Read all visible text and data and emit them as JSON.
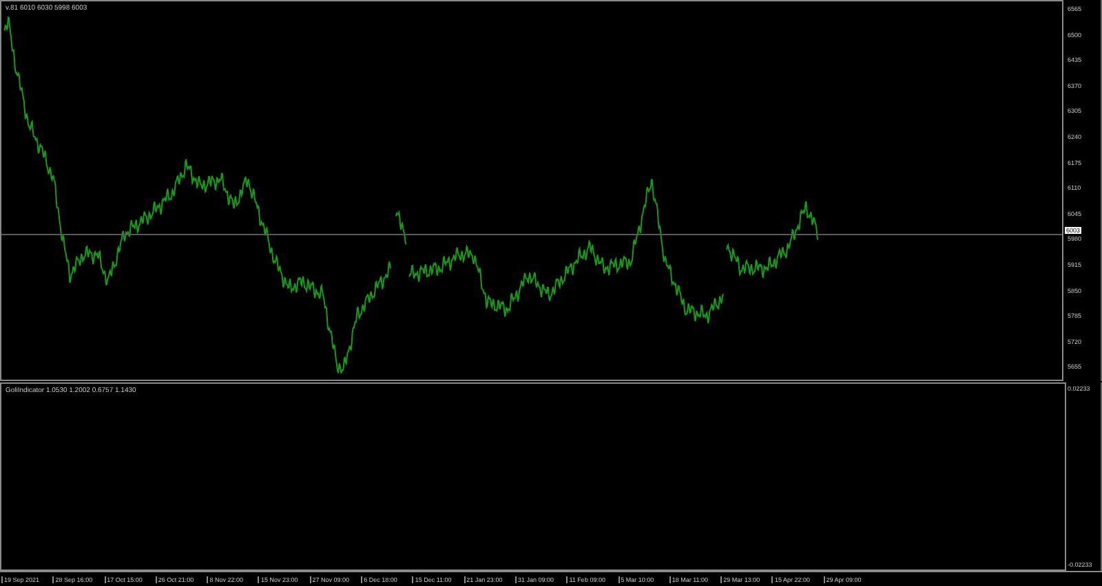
{
  "chart": {
    "header": "v.81  6010 6030 5998 6003",
    "current_price": "6003",
    "price_axis": [
      "6565",
      "6500",
      "6435",
      "6370",
      "6305",
      "6240",
      "6175",
      "6110",
      "6045",
      "5980",
      "5915",
      "5850",
      "5785",
      "5720",
      "5655"
    ]
  },
  "indicator": {
    "label": "GoliIndicator 1.0530 1.2002 0.6757 1.1430",
    "axis": [
      "0.02233",
      "-0.02233"
    ]
  },
  "time_axis": [
    "19 Sep 2021",
    "28 Sep 16:00",
    "17 Oct 15:00",
    "26 Oct 21:00",
    "8 Nov 22:00",
    "15 Nov 23:00",
    "27 Nov 09:00",
    "6 Dec 18:00",
    "15 Dec 11:00",
    "21 Jan 23:00",
    "31 Jan 09:00",
    "11 Feb 09:00",
    "5 Mar 10:00",
    "18 Mar 11:00",
    "29 Mar 13:00",
    "15 Apr 22:00",
    "29 Apr 09:00"
  ]
}
